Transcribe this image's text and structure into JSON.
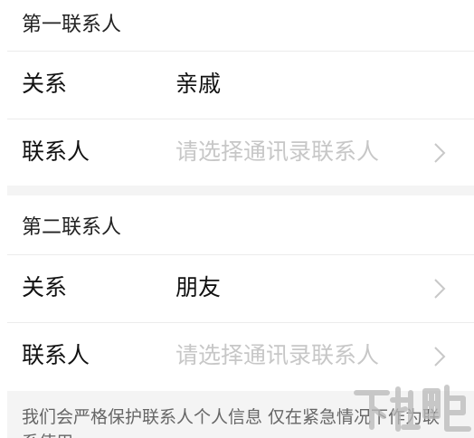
{
  "sections": [
    {
      "title": "第一联系人",
      "rows": [
        {
          "label": "关系",
          "value": "亲戚"
        },
        {
          "label": "联系人",
          "placeholder": "请选择通讯录联系人"
        }
      ]
    },
    {
      "title": "第二联系人",
      "rows": [
        {
          "label": "关系",
          "value": "朋友"
        },
        {
          "label": "联系人",
          "placeholder": "请选择通讯录联系人"
        }
      ]
    }
  ],
  "notice": "我们会严格保护联系人个人信息 仅在紧急情况下作为联系使用",
  "colors": {
    "background": "#ffffff",
    "separator": "#f4f4f4",
    "placeholder": "#c7c7c7",
    "chevron": "#c8c8c8"
  },
  "icons": {
    "chevron": "chevron-right-icon",
    "watermark": "xiazaiba-watermark"
  }
}
